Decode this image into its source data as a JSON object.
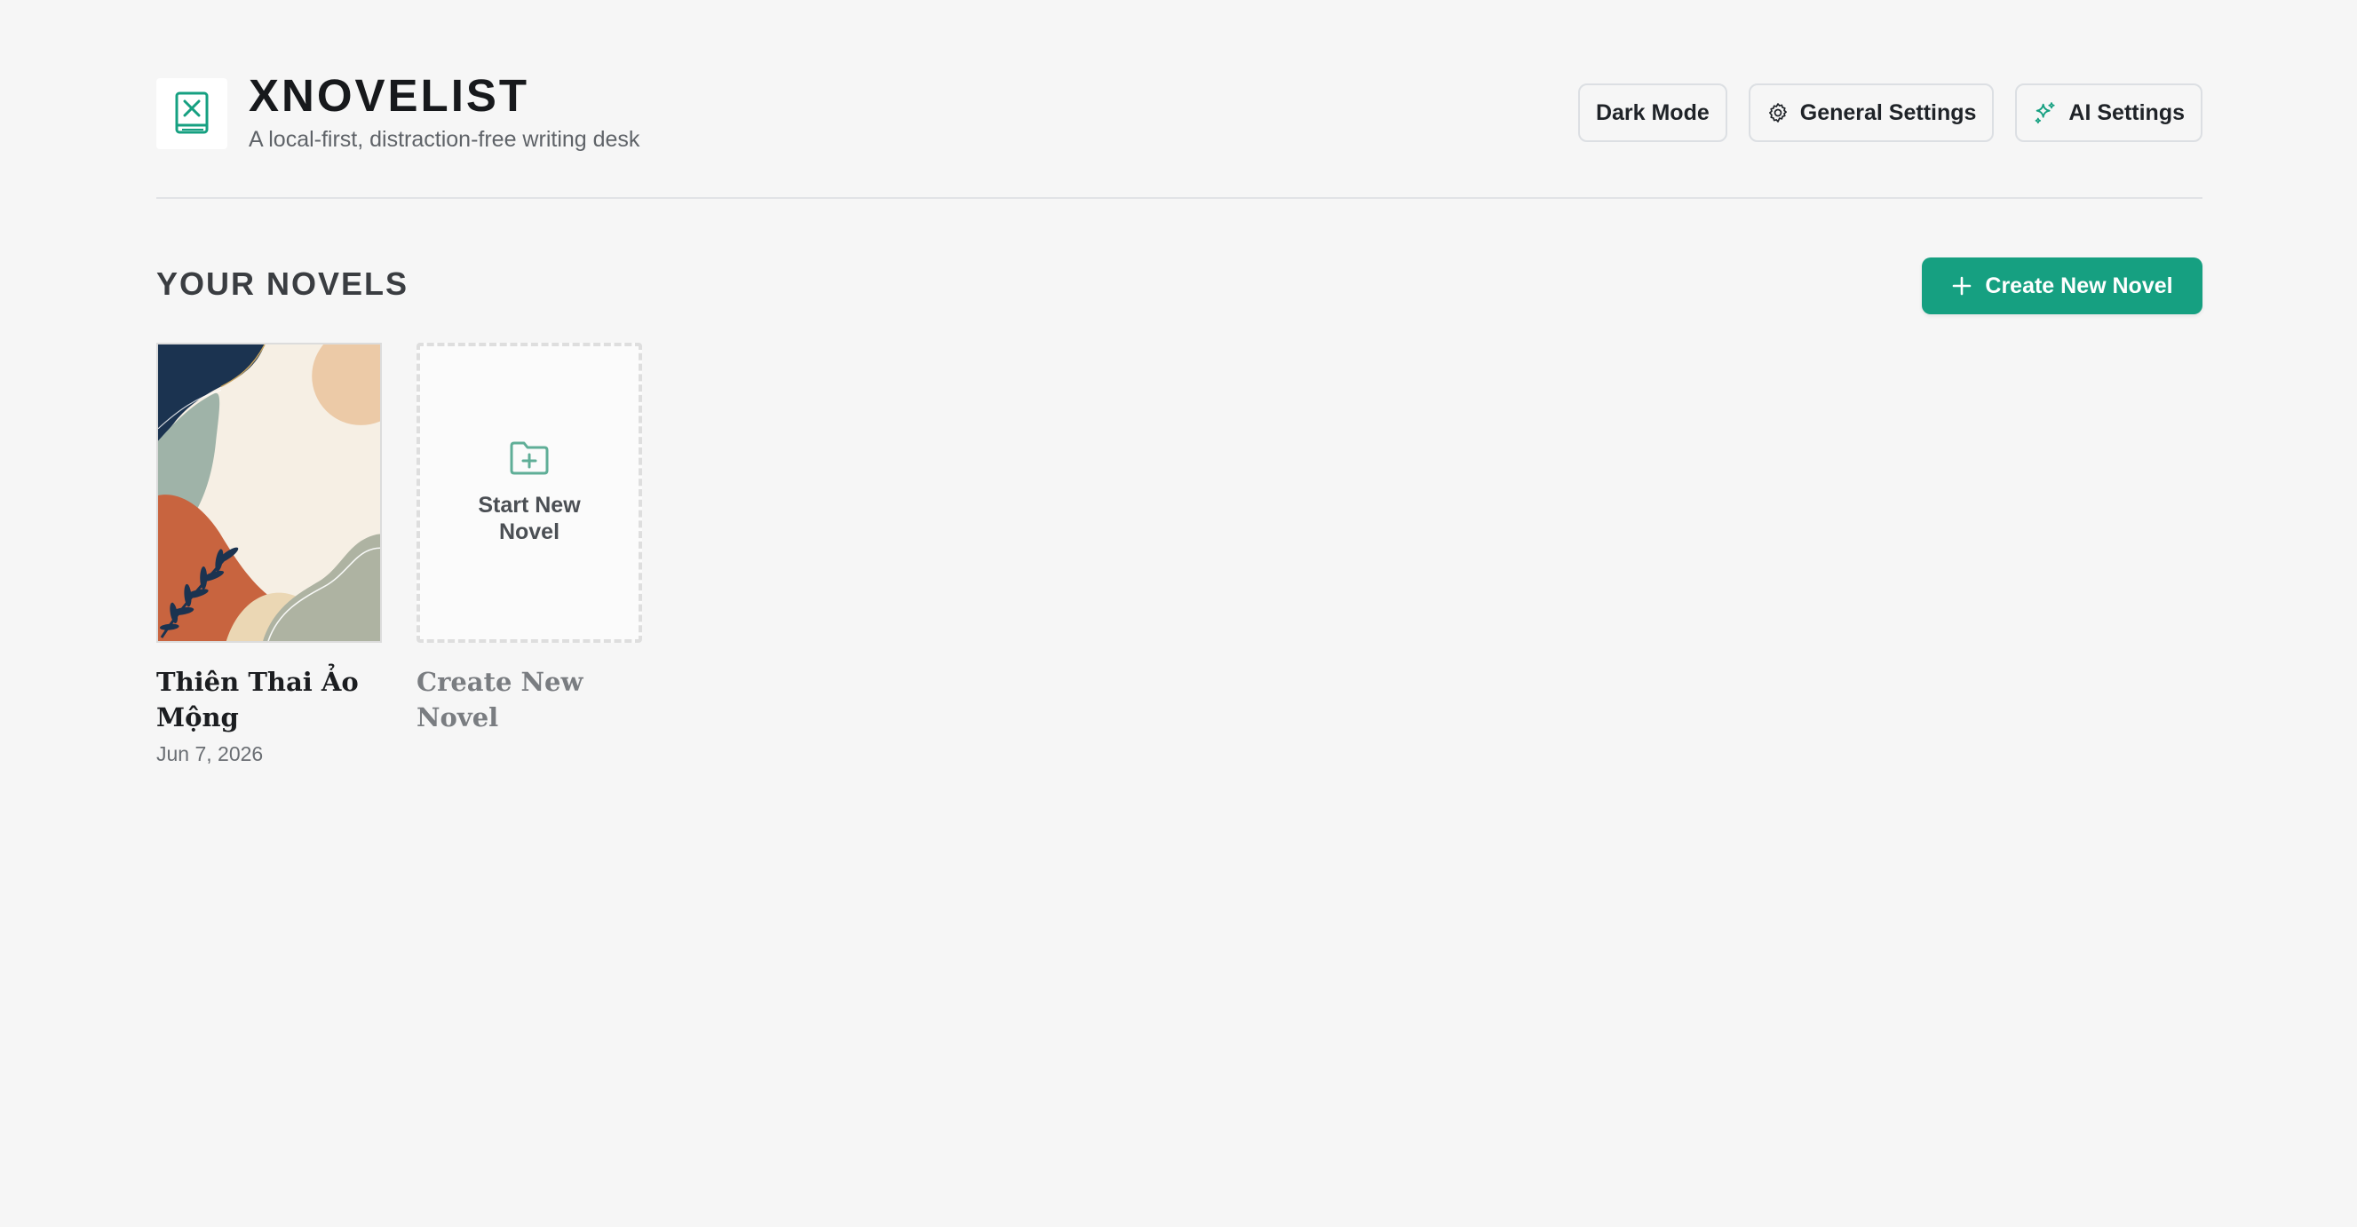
{
  "app": {
    "title": "XNOVELIST",
    "subtitle": "A local-first, distraction-free writing desk"
  },
  "header_actions": {
    "dark_mode": "Dark Mode",
    "general_settings": "General Settings",
    "ai_settings": "AI Settings"
  },
  "library": {
    "section_title": "YOUR NOVELS",
    "create_button": "Create New Novel",
    "novels": [
      {
        "title": "Thiên Thai Ảo Mộng",
        "date": "Jun 7, 2026"
      }
    ],
    "new_novel_card": {
      "cover_label": "Start New Novel",
      "title": "Create New Novel"
    }
  },
  "colors": {
    "accent": "#16a081",
    "background": "#f6f6f6",
    "cover_navy": "#1b3350",
    "cover_orange": "#c8643f",
    "cover_sage": "#9fb3a8",
    "cover_peach": "#eccaa7",
    "cover_cream": "#f6efe4"
  },
  "icons": {
    "logo": "book-icon",
    "general_settings": "gear-icon",
    "ai_settings": "sparkles-icon",
    "create": "plus-icon",
    "new_novel": "folder-plus-icon"
  }
}
